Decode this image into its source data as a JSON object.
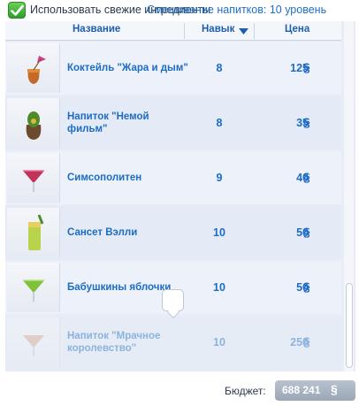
{
  "top": {
    "fresh_label": "Использовать свежие ингредиенты",
    "skill_label": "Смешивание напитков: 10 уровень"
  },
  "table": {
    "headers": {
      "name": "Название",
      "skill": "Навык",
      "price": "Цена"
    },
    "rows": [
      {
        "name": "Коктейль \"Жара и дым\"",
        "skill": "8",
        "price": "125",
        "currency": "§",
        "icon": "cocktail-glass-icon"
      },
      {
        "name": "Напиток \"Немой фильм\"",
        "skill": "8",
        "price": "35",
        "currency": "§",
        "icon": "cocktail-glass-icon"
      },
      {
        "name": "Симсополитен",
        "skill": "9",
        "price": "40",
        "currency": "§",
        "icon": "martini-glass-icon"
      },
      {
        "name": "Сансет Вэлли",
        "skill": "10",
        "price": "50",
        "currency": "§",
        "icon": "tall-glass-icon"
      },
      {
        "name": "Бабушкины яблочки",
        "skill": "10",
        "price": "50",
        "currency": "§",
        "icon": "martini-glass-icon"
      },
      {
        "name": "Напиток \"Мрачное королевство\"",
        "skill": "10",
        "price": "250",
        "currency": "§",
        "icon": "martini-glass-icon"
      }
    ]
  },
  "budget": {
    "label": "Бюджет:",
    "value": "688 241",
    "currency": "§"
  },
  "colors": {
    "accent": "#1d6cc4",
    "check": "#3aa82f"
  }
}
